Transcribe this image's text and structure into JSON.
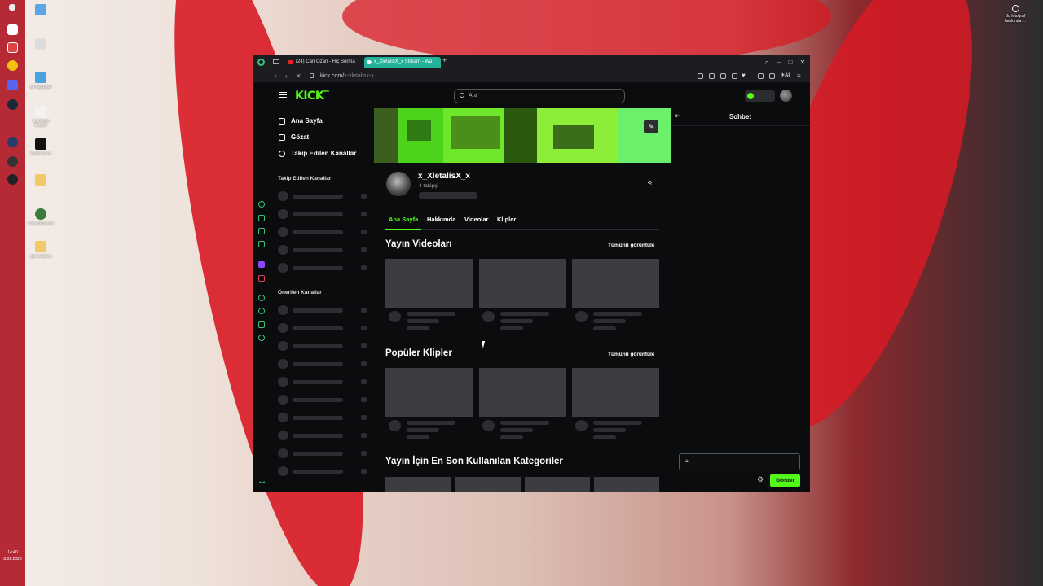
{
  "desktop": {
    "photo_info_label": "Bu fotoğraf hakkında ...",
    "clock_time": "14:40",
    "clock_date": "8.02.2026",
    "icons": [
      {
        "label": "Bu Bilgisayar"
      },
      {
        "label": "Yeni Metin Belgesi"
      },
      {
        "label": "Fast Reduce"
      },
      {
        "label": "MSI Afterburner"
      },
      {
        "label": "god of sparta"
      }
    ]
  },
  "browser": {
    "tabs": [
      {
        "title": "(24) Can Ozan - Hiç Sorma"
      },
      {
        "title": "x_XletalisX_x Stream - Wa"
      }
    ],
    "url_host": "kick.com/",
    "url_path": "x-xletalisx-x",
    "ext_ai_label": "AI"
  },
  "kick": {
    "logo": "KICK",
    "logo_badge": "BETA",
    "search_placeholder": "Ara",
    "nav": [
      {
        "label": "Ana Sayfa"
      },
      {
        "label": "Gözat"
      },
      {
        "label": "Takip Edilen Kanallar"
      }
    ],
    "followed_section": "Takip Edilen Kanallar",
    "recommended_section": "Önerilen Kanallar",
    "channel": {
      "name": "x_XletalisX_x",
      "followers": "4 takipçi"
    },
    "channel_tabs": [
      {
        "label": "Ana Sayfa",
        "active": true
      },
      {
        "label": "Hakkımda",
        "active": false
      },
      {
        "label": "Videolar",
        "active": false
      },
      {
        "label": "Klipler",
        "active": false
      }
    ],
    "sections": {
      "videos_title": "Yayın Videoları",
      "videos_link": "Tümünü görüntüle",
      "clips_title": "Popüler Klipler",
      "clips_link": "Tümünü görüntüle",
      "categories_title": "Yayın İçin En Son Kullanılan Kategoriler"
    },
    "chat": {
      "title": "Sohbet",
      "send_label": "Gönder"
    },
    "accent_color": "#53fc18"
  }
}
